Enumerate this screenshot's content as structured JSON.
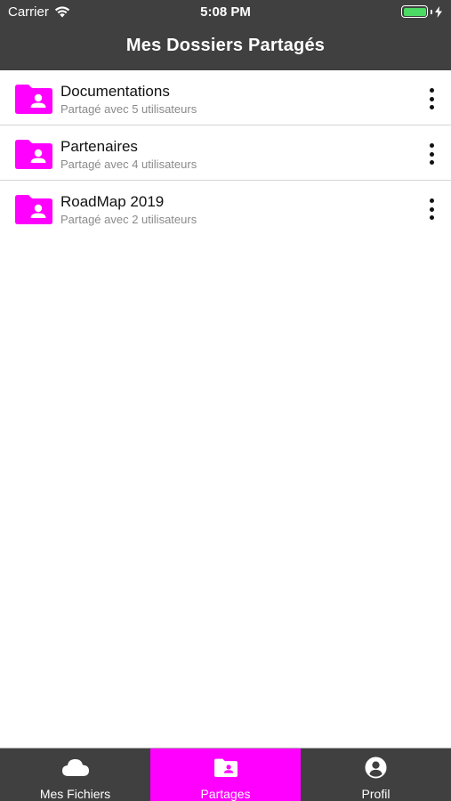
{
  "status_bar": {
    "carrier": "Carrier",
    "time": "5:08 PM",
    "battery_color": "#4cd964"
  },
  "nav": {
    "title": "Mes Dossiers Partagés",
    "background": "#404040"
  },
  "folders": [
    {
      "name": "Documentations",
      "subtitle": "Partagé avec 5 utilisateurs",
      "icon": "shared-folder-icon"
    },
    {
      "name": "Partenaires",
      "subtitle": "Partagé avec 4 utilisateurs",
      "icon": "shared-folder-icon"
    },
    {
      "name": "RoadMap 2019",
      "subtitle": "Partagé avec 2 utilisateurs",
      "icon": "shared-folder-icon"
    }
  ],
  "tabbar": {
    "tabs": [
      {
        "label": "Mes Fichiers",
        "icon": "cloud-icon",
        "active": false
      },
      {
        "label": "Partages",
        "icon": "shared-folder-icon",
        "active": true
      },
      {
        "label": "Profil",
        "icon": "user-circle-icon",
        "active": false
      }
    ],
    "accent_color": "#ff00ff"
  }
}
